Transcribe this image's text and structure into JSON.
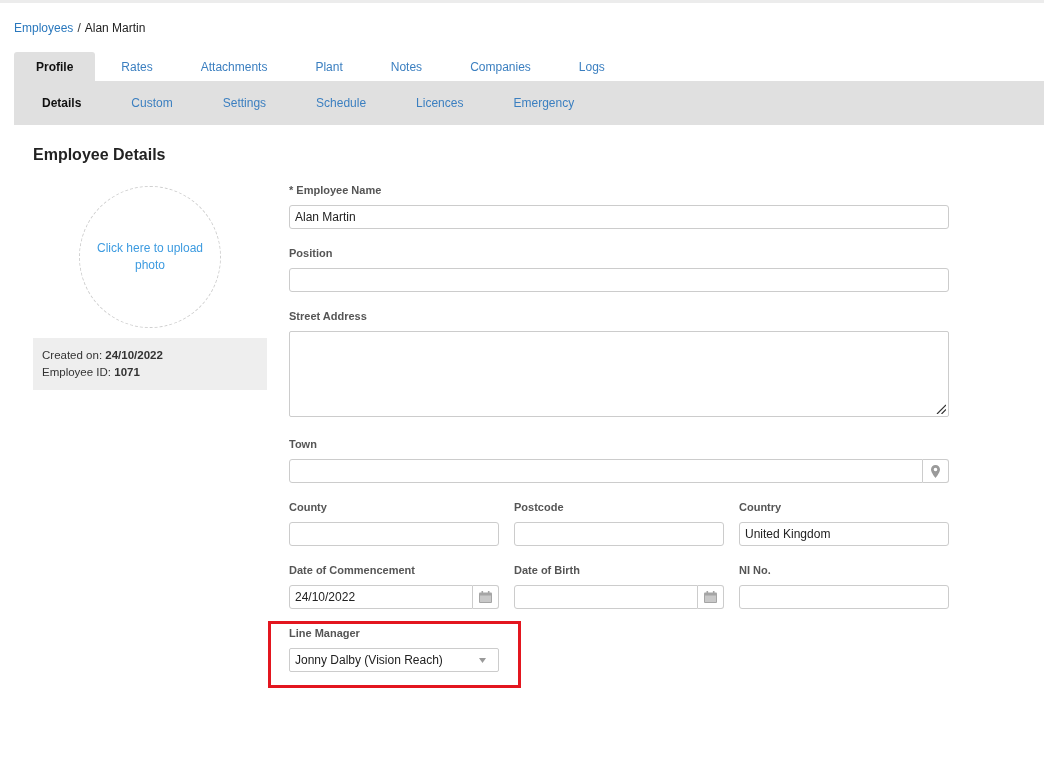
{
  "breadcrumb": {
    "items": [
      {
        "label": "Employees",
        "kind": "link"
      },
      {
        "label": "Alan Martin",
        "kind": "current"
      }
    ],
    "separator": "/"
  },
  "tabs": [
    {
      "label": "Profile",
      "selected": true
    },
    {
      "label": "Rates",
      "selected": false
    },
    {
      "label": "Attachments",
      "selected": false
    },
    {
      "label": "Plant",
      "selected": false
    },
    {
      "label": "Notes",
      "selected": false
    },
    {
      "label": "Companies",
      "selected": false
    },
    {
      "label": "Logs",
      "selected": false
    }
  ],
  "subtabs": [
    {
      "label": "Details",
      "selected": true
    },
    {
      "label": "Custom",
      "selected": false
    },
    {
      "label": "Settings",
      "selected": false
    },
    {
      "label": "Schedule",
      "selected": false
    },
    {
      "label": "Licences",
      "selected": false
    },
    {
      "label": "Emergency",
      "selected": false
    }
  ],
  "section_title": "Employee Details",
  "photo_upload": {
    "label": "Click here to upload photo"
  },
  "record_info": [
    "Created on: **24/10/2022**",
    "Employee ID: **1071**"
  ],
  "form": {
    "rows": [
      {
        "fields": [
          {
            "label": "* Employee Name",
            "kind": "text",
            "value": "Alan Martin"
          }
        ]
      },
      {
        "fields": [
          {
            "label": "Position",
            "kind": "text"
          }
        ]
      },
      {
        "fields": [
          {
            "label": "Street Address",
            "kind": "textarea"
          }
        ]
      },
      {
        "fields": [
          {
            "label": "Town",
            "kind": "location"
          }
        ]
      },
      {
        "fields": [
          {
            "label": "County",
            "kind": "text"
          },
          {
            "label": "Postcode",
            "kind": "text"
          },
          {
            "label": "Country",
            "kind": "text",
            "value": "United Kingdom"
          }
        ]
      },
      {
        "fields": [
          {
            "label": "Date of Commencement",
            "kind": "date",
            "value": "24/10/2022"
          },
          {
            "label": "Date of Birth",
            "kind": "date"
          },
          {
            "label": "NI No.",
            "kind": "text"
          }
        ]
      },
      {
        "fields": [
          {
            "label": "Line Manager",
            "kind": "select",
            "value": "Jonny Dalby (Vision Reach)",
            "highlighted": true
          }
        ]
      }
    ]
  }
}
